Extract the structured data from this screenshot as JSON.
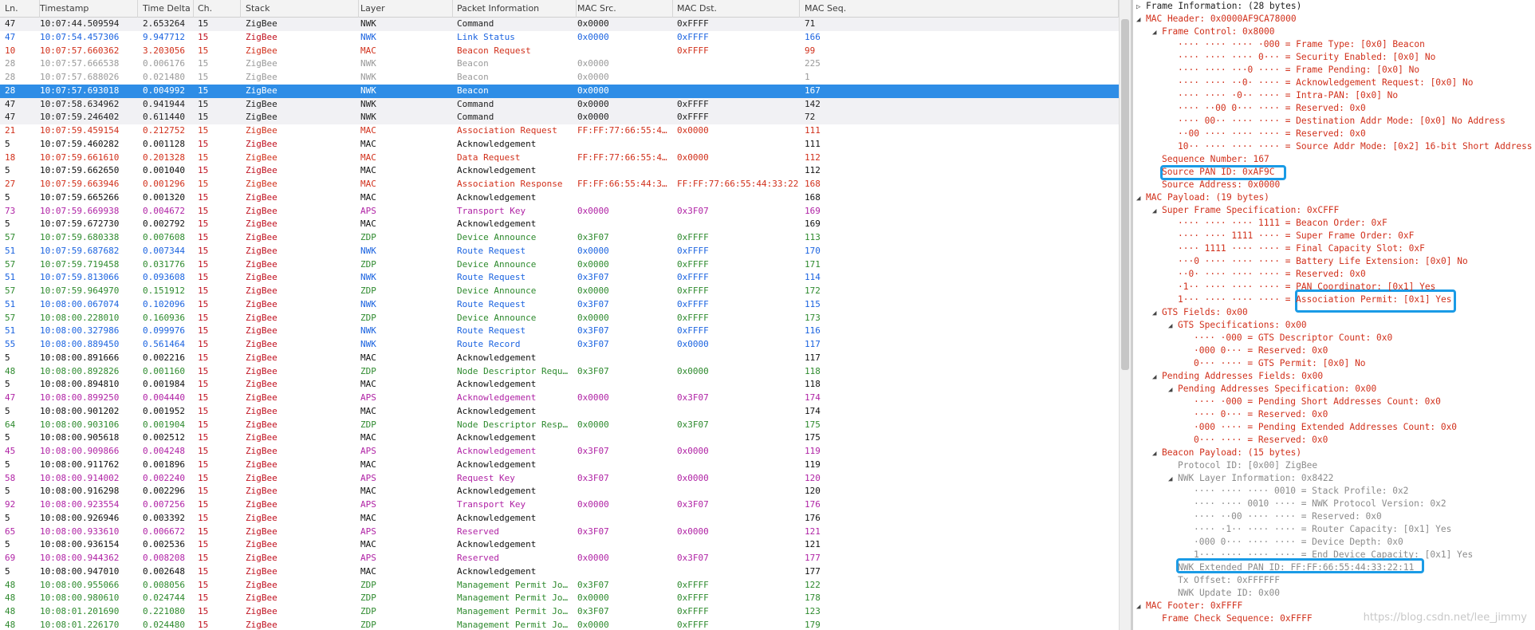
{
  "columns": [
    "Ln.",
    "Timestamp",
    "Time Delta",
    "Ch.",
    "Stack",
    "Layer",
    "Packet Information",
    "MAC Src.",
    "MAC Dst.",
    "MAC Seq."
  ],
  "packets": [
    {
      "ln": "47",
      "ts": "10:07:44.509594",
      "td": "2.653264",
      "ch": "15",
      "st": "ZigBee",
      "ly": "NWK",
      "pi": "Command",
      "ms": "0x0000",
      "md": "0xFFFF",
      "sq": "71",
      "kind": "cmd",
      "alt": true
    },
    {
      "ln": "47",
      "ts": "10:07:54.457306",
      "td": "9.947712",
      "ch": "15",
      "st": "ZigBee",
      "ly": "NWK",
      "pi": "Link Status",
      "ms": "0x0000",
      "md": "0xFFFF",
      "sq": "166",
      "kind": "nwk",
      "alt": false
    },
    {
      "ln": "10",
      "ts": "10:07:57.660362",
      "td": "3.203056",
      "ch": "15",
      "st": "ZigBee",
      "ly": "MAC",
      "pi": "Beacon Request",
      "ms": "",
      "md": "0xFFFF",
      "sq": "99",
      "kind": "mac",
      "alt": false
    },
    {
      "ln": "28",
      "ts": "10:07:57.666538",
      "td": "0.006176",
      "ch": "15",
      "st": "ZigBee",
      "ly": "NWK",
      "pi": "Beacon",
      "ms": "0x0000",
      "md": "",
      "sq": "225",
      "kind": "beacon",
      "alt": false
    },
    {
      "ln": "28",
      "ts": "10:07:57.688026",
      "td": "0.021480",
      "ch": "15",
      "st": "ZigBee",
      "ly": "NWK",
      "pi": "Beacon",
      "ms": "0x0000",
      "md": "",
      "sq": "1",
      "kind": "beacon",
      "alt": false
    },
    {
      "ln": "28",
      "ts": "10:07:57.693018",
      "td": "0.004992",
      "ch": "15",
      "st": "ZigBee",
      "ly": "NWK",
      "pi": "Beacon",
      "ms": "0x0000",
      "md": "",
      "sq": "167",
      "kind": "beacon",
      "alt": false,
      "selected": true
    },
    {
      "ln": "47",
      "ts": "10:07:58.634962",
      "td": "0.941944",
      "ch": "15",
      "st": "ZigBee",
      "ly": "NWK",
      "pi": "Command",
      "ms": "0x0000",
      "md": "0xFFFF",
      "sq": "142",
      "kind": "cmd",
      "alt": true
    },
    {
      "ln": "47",
      "ts": "10:07:59.246402",
      "td": "0.611440",
      "ch": "15",
      "st": "ZigBee",
      "ly": "NWK",
      "pi": "Command",
      "ms": "0x0000",
      "md": "0xFFFF",
      "sq": "72",
      "kind": "cmd",
      "alt": true
    },
    {
      "ln": "21",
      "ts": "10:07:59.459154",
      "td": "0.212752",
      "ch": "15",
      "st": "ZigBee",
      "ly": "MAC",
      "pi": "Association Request",
      "ms": "FF:FF:77:66:55:4…",
      "md": "0x0000",
      "sq": "111",
      "kind": "mac",
      "alt": false
    },
    {
      "ln": "5",
      "ts": "10:07:59.460282",
      "td": "0.001128",
      "ch": "15",
      "st": "ZigBee",
      "ly": "MAC",
      "pi": "Acknowledgement",
      "ms": "",
      "md": "",
      "sq": "111",
      "kind": "ack",
      "alt": false
    },
    {
      "ln": "18",
      "ts": "10:07:59.661610",
      "td": "0.201328",
      "ch": "15",
      "st": "ZigBee",
      "ly": "MAC",
      "pi": "Data Request",
      "ms": "FF:FF:77:66:55:4…",
      "md": "0x0000",
      "sq": "112",
      "kind": "mac",
      "alt": false
    },
    {
      "ln": "5",
      "ts": "10:07:59.662650",
      "td": "0.001040",
      "ch": "15",
      "st": "ZigBee",
      "ly": "MAC",
      "pi": "Acknowledgement",
      "ms": "",
      "md": "",
      "sq": "112",
      "kind": "ack",
      "alt": false
    },
    {
      "ln": "27",
      "ts": "10:07:59.663946",
      "td": "0.001296",
      "ch": "15",
      "st": "ZigBee",
      "ly": "MAC",
      "pi": "Association Response",
      "ms": "FF:FF:66:55:44:3…",
      "md": "FF:FF:77:66:55:44:33:22",
      "sq": "168",
      "kind": "mac",
      "alt": false
    },
    {
      "ln": "5",
      "ts": "10:07:59.665266",
      "td": "0.001320",
      "ch": "15",
      "st": "ZigBee",
      "ly": "MAC",
      "pi": "Acknowledgement",
      "ms": "",
      "md": "",
      "sq": "168",
      "kind": "ack",
      "alt": false
    },
    {
      "ln": "73",
      "ts": "10:07:59.669938",
      "td": "0.004672",
      "ch": "15",
      "st": "ZigBee",
      "ly": "APS",
      "pi": "Transport Key",
      "ms": "0x0000",
      "md": "0x3F07",
      "sq": "169",
      "kind": "aps",
      "alt": false
    },
    {
      "ln": "5",
      "ts": "10:07:59.672730",
      "td": "0.002792",
      "ch": "15",
      "st": "ZigBee",
      "ly": "MAC",
      "pi": "Acknowledgement",
      "ms": "",
      "md": "",
      "sq": "169",
      "kind": "ack",
      "alt": false
    },
    {
      "ln": "57",
      "ts": "10:07:59.680338",
      "td": "0.007608",
      "ch": "15",
      "st": "ZigBee",
      "ly": "ZDP",
      "pi": "Device Announce",
      "ms": "0x3F07",
      "md": "0xFFFF",
      "sq": "113",
      "kind": "zdp",
      "alt": false
    },
    {
      "ln": "51",
      "ts": "10:07:59.687682",
      "td": "0.007344",
      "ch": "15",
      "st": "ZigBee",
      "ly": "NWK",
      "pi": "Route Request",
      "ms": "0x0000",
      "md": "0xFFFF",
      "sq": "170",
      "kind": "nwk",
      "alt": false
    },
    {
      "ln": "57",
      "ts": "10:07:59.719458",
      "td": "0.031776",
      "ch": "15",
      "st": "ZigBee",
      "ly": "ZDP",
      "pi": "Device Announce",
      "ms": "0x0000",
      "md": "0xFFFF",
      "sq": "171",
      "kind": "zdp",
      "alt": false
    },
    {
      "ln": "51",
      "ts": "10:07:59.813066",
      "td": "0.093608",
      "ch": "15",
      "st": "ZigBee",
      "ly": "NWK",
      "pi": "Route Request",
      "ms": "0x3F07",
      "md": "0xFFFF",
      "sq": "114",
      "kind": "nwk",
      "alt": false
    },
    {
      "ln": "57",
      "ts": "10:07:59.964970",
      "td": "0.151912",
      "ch": "15",
      "st": "ZigBee",
      "ly": "ZDP",
      "pi": "Device Announce",
      "ms": "0x0000",
      "md": "0xFFFF",
      "sq": "172",
      "kind": "zdp",
      "alt": false
    },
    {
      "ln": "51",
      "ts": "10:08:00.067074",
      "td": "0.102096",
      "ch": "15",
      "st": "ZigBee",
      "ly": "NWK",
      "pi": "Route Request",
      "ms": "0x3F07",
      "md": "0xFFFF",
      "sq": "115",
      "kind": "nwk",
      "alt": false
    },
    {
      "ln": "57",
      "ts": "10:08:00.228010",
      "td": "0.160936",
      "ch": "15",
      "st": "ZigBee",
      "ly": "ZDP",
      "pi": "Device Announce",
      "ms": "0x0000",
      "md": "0xFFFF",
      "sq": "173",
      "kind": "zdp",
      "alt": false
    },
    {
      "ln": "51",
      "ts": "10:08:00.327986",
      "td": "0.099976",
      "ch": "15",
      "st": "ZigBee",
      "ly": "NWK",
      "pi": "Route Request",
      "ms": "0x3F07",
      "md": "0xFFFF",
      "sq": "116",
      "kind": "nwk",
      "alt": false
    },
    {
      "ln": "55",
      "ts": "10:08:00.889450",
      "td": "0.561464",
      "ch": "15",
      "st": "ZigBee",
      "ly": "NWK",
      "pi": "Route Record",
      "ms": "0x3F07",
      "md": "0x0000",
      "sq": "117",
      "kind": "nwk",
      "alt": false
    },
    {
      "ln": "5",
      "ts": "10:08:00.891666",
      "td": "0.002216",
      "ch": "15",
      "st": "ZigBee",
      "ly": "MAC",
      "pi": "Acknowledgement",
      "ms": "",
      "md": "",
      "sq": "117",
      "kind": "ack",
      "alt": false
    },
    {
      "ln": "48",
      "ts": "10:08:00.892826",
      "td": "0.001160",
      "ch": "15",
      "st": "ZigBee",
      "ly": "ZDP",
      "pi": "Node Descriptor Requ…",
      "ms": "0x3F07",
      "md": "0x0000",
      "sq": "118",
      "kind": "zdp",
      "alt": false
    },
    {
      "ln": "5",
      "ts": "10:08:00.894810",
      "td": "0.001984",
      "ch": "15",
      "st": "ZigBee",
      "ly": "MAC",
      "pi": "Acknowledgement",
      "ms": "",
      "md": "",
      "sq": "118",
      "kind": "ack",
      "alt": false
    },
    {
      "ln": "47",
      "ts": "10:08:00.899250",
      "td": "0.004440",
      "ch": "15",
      "st": "ZigBee",
      "ly": "APS",
      "pi": "Acknowledgement",
      "ms": "0x0000",
      "md": "0x3F07",
      "sq": "174",
      "kind": "aps",
      "alt": false
    },
    {
      "ln": "5",
      "ts": "10:08:00.901202",
      "td": "0.001952",
      "ch": "15",
      "st": "ZigBee",
      "ly": "MAC",
      "pi": "Acknowledgement",
      "ms": "",
      "md": "",
      "sq": "174",
      "kind": "ack",
      "alt": false
    },
    {
      "ln": "64",
      "ts": "10:08:00.903106",
      "td": "0.001904",
      "ch": "15",
      "st": "ZigBee",
      "ly": "ZDP",
      "pi": "Node Descriptor Resp…",
      "ms": "0x0000",
      "md": "0x3F07",
      "sq": "175",
      "kind": "zdp",
      "alt": false
    },
    {
      "ln": "5",
      "ts": "10:08:00.905618",
      "td": "0.002512",
      "ch": "15",
      "st": "ZigBee",
      "ly": "MAC",
      "pi": "Acknowledgement",
      "ms": "",
      "md": "",
      "sq": "175",
      "kind": "ack",
      "alt": false
    },
    {
      "ln": "45",
      "ts": "10:08:00.909866",
      "td": "0.004248",
      "ch": "15",
      "st": "ZigBee",
      "ly": "APS",
      "pi": "Acknowledgement",
      "ms": "0x3F07",
      "md": "0x0000",
      "sq": "119",
      "kind": "aps",
      "alt": false
    },
    {
      "ln": "5",
      "ts": "10:08:00.911762",
      "td": "0.001896",
      "ch": "15",
      "st": "ZigBee",
      "ly": "MAC",
      "pi": "Acknowledgement",
      "ms": "",
      "md": "",
      "sq": "119",
      "kind": "ack",
      "alt": false
    },
    {
      "ln": "58",
      "ts": "10:08:00.914002",
      "td": "0.002240",
      "ch": "15",
      "st": "ZigBee",
      "ly": "APS",
      "pi": "Request Key",
      "ms": "0x3F07",
      "md": "0x0000",
      "sq": "120",
      "kind": "aps",
      "alt": false
    },
    {
      "ln": "5",
      "ts": "10:08:00.916298",
      "td": "0.002296",
      "ch": "15",
      "st": "ZigBee",
      "ly": "MAC",
      "pi": "Acknowledgement",
      "ms": "",
      "md": "",
      "sq": "120",
      "kind": "ack",
      "alt": false
    },
    {
      "ln": "92",
      "ts": "10:08:00.923554",
      "td": "0.007256",
      "ch": "15",
      "st": "ZigBee",
      "ly": "APS",
      "pi": "Transport Key",
      "ms": "0x0000",
      "md": "0x3F07",
      "sq": "176",
      "kind": "aps",
      "alt": false
    },
    {
      "ln": "5",
      "ts": "10:08:00.926946",
      "td": "0.003392",
      "ch": "15",
      "st": "ZigBee",
      "ly": "MAC",
      "pi": "Acknowledgement",
      "ms": "",
      "md": "",
      "sq": "176",
      "kind": "ack",
      "alt": false
    },
    {
      "ln": "65",
      "ts": "10:08:00.933610",
      "td": "0.006672",
      "ch": "15",
      "st": "ZigBee",
      "ly": "APS",
      "pi": "Reserved",
      "ms": "0x3F07",
      "md": "0x0000",
      "sq": "121",
      "kind": "aps",
      "alt": false
    },
    {
      "ln": "5",
      "ts": "10:08:00.936154",
      "td": "0.002536",
      "ch": "15",
      "st": "ZigBee",
      "ly": "MAC",
      "pi": "Acknowledgement",
      "ms": "",
      "md": "",
      "sq": "121",
      "kind": "ack",
      "alt": false
    },
    {
      "ln": "69",
      "ts": "10:08:00.944362",
      "td": "0.008208",
      "ch": "15",
      "st": "ZigBee",
      "ly": "APS",
      "pi": "Reserved",
      "ms": "0x0000",
      "md": "0x3F07",
      "sq": "177",
      "kind": "aps",
      "alt": false
    },
    {
      "ln": "5",
      "ts": "10:08:00.947010",
      "td": "0.002648",
      "ch": "15",
      "st": "ZigBee",
      "ly": "MAC",
      "pi": "Acknowledgement",
      "ms": "",
      "md": "",
      "sq": "177",
      "kind": "ack",
      "alt": false
    },
    {
      "ln": "48",
      "ts": "10:08:00.955066",
      "td": "0.008056",
      "ch": "15",
      "st": "ZigBee",
      "ly": "ZDP",
      "pi": "Management Permit Jo…",
      "ms": "0x3F07",
      "md": "0xFFFF",
      "sq": "122",
      "kind": "zdp",
      "alt": false
    },
    {
      "ln": "48",
      "ts": "10:08:00.980610",
      "td": "0.024744",
      "ch": "15",
      "st": "ZigBee",
      "ly": "ZDP",
      "pi": "Management Permit Jo…",
      "ms": "0x0000",
      "md": "0xFFFF",
      "sq": "178",
      "kind": "zdp",
      "alt": false
    },
    {
      "ln": "48",
      "ts": "10:08:01.201690",
      "td": "0.221080",
      "ch": "15",
      "st": "ZigBee",
      "ly": "ZDP",
      "pi": "Management Permit Jo…",
      "ms": "0x3F07",
      "md": "0xFFFF",
      "sq": "123",
      "kind": "zdp",
      "alt": false
    },
    {
      "ln": "48",
      "ts": "10:08:01.226170",
      "td": "0.024480",
      "ch": "15",
      "st": "ZigBee",
      "ly": "ZDP",
      "pi": "Management Permit Jo…",
      "ms": "0x0000",
      "md": "0xFFFF",
      "sq": "179",
      "kind": "zdp",
      "alt": false
    }
  ],
  "details": [
    {
      "t": "Frame Information: (28 bytes)",
      "lvl": 0,
      "exp": "collapsed",
      "c": "black"
    },
    {
      "t": "MAC Header: 0x0000AF9CA78000",
      "lvl": 0,
      "exp": "expanded"
    },
    {
      "t": "Frame Control: 0x8000",
      "lvl": 1,
      "exp": "expanded"
    },
    {
      "t": "···· ···· ···· ·000 = Frame Type: [0x0] Beacon",
      "lvl": 2
    },
    {
      "t": "···· ···· ···· 0··· = Security Enabled: [0x0] No",
      "lvl": 2
    },
    {
      "t": "···· ···· ···0 ···· = Frame Pending: [0x0] No",
      "lvl": 2
    },
    {
      "t": "···· ···· ··0· ···· = Acknowledgement Request: [0x0] No",
      "lvl": 2
    },
    {
      "t": "···· ···· ·0·· ···· = Intra-PAN: [0x0] No",
      "lvl": 2
    },
    {
      "t": "···· ··00 0··· ···· = Reserved: 0x0",
      "lvl": 2
    },
    {
      "t": "···· 00·· ···· ···· = Destination Addr Mode: [0x0] No Address",
      "lvl": 2
    },
    {
      "t": "··00 ···· ···· ···· = Reserved: 0x0",
      "lvl": 2
    },
    {
      "t": "10·· ···· ···· ···· = Source Addr Mode: [0x2] 16-bit Short Address",
      "lvl": 2
    },
    {
      "t": "Sequence Number: 167",
      "lvl": 1
    },
    {
      "t": "Source PAN ID: 0xAF9C",
      "lvl": 1
    },
    {
      "t": "Source Address: 0x0000",
      "lvl": 1
    },
    {
      "t": "MAC Payload: (19 bytes)",
      "lvl": 0,
      "exp": "expanded"
    },
    {
      "t": "Super Frame Specification: 0xCFFF",
      "lvl": 1,
      "exp": "expanded"
    },
    {
      "t": "···· ···· ···· 1111 = Beacon Order: 0xF",
      "lvl": 2
    },
    {
      "t": "···· ···· 1111 ···· = Super Frame Order: 0xF",
      "lvl": 2
    },
    {
      "t": "···· 1111 ···· ···· = Final Capacity Slot: 0xF",
      "lvl": 2
    },
    {
      "t": "···0 ···· ···· ···· = Battery Life Extension: [0x0] No",
      "lvl": 2
    },
    {
      "t": "··0· ···· ···· ···· = Reserved: 0x0",
      "lvl": 2
    },
    {
      "t": "·1·· ···· ···· ···· = PAN Coordinator: [0x1] Yes",
      "lvl": 2
    },
    {
      "t": "1··· ···· ···· ···· = Association Permit: [0x1] Yes",
      "lvl": 2
    },
    {
      "t": "GTS Fields: 0x00",
      "lvl": 1,
      "exp": "expanded"
    },
    {
      "t": "GTS Specifications: 0x00",
      "lvl": 2,
      "exp": "expanded"
    },
    {
      "t": "···· ·000 = GTS Descriptor Count: 0x0",
      "lvl": 3
    },
    {
      "t": "·000 0··· = Reserved: 0x0",
      "lvl": 3
    },
    {
      "t": "0··· ···· = GTS Permit: [0x0] No",
      "lvl": 3
    },
    {
      "t": "Pending Addresses Fields: 0x00",
      "lvl": 1,
      "exp": "expanded"
    },
    {
      "t": "Pending Addresses Specification: 0x00",
      "lvl": 2,
      "exp": "expanded"
    },
    {
      "t": "···· ·000 = Pending Short Addresses Count: 0x0",
      "lvl": 3
    },
    {
      "t": "···· 0··· = Reserved: 0x0",
      "lvl": 3
    },
    {
      "t": "·000 ···· = Pending Extended Addresses Count: 0x0",
      "lvl": 3
    },
    {
      "t": "0··· ···· = Reserved: 0x0",
      "lvl": 3
    },
    {
      "t": "Beacon Payload: (15 bytes)",
      "lvl": 1,
      "exp": "expanded"
    },
    {
      "t": "Protocol ID: [0x00] ZigBee",
      "lvl": 2,
      "c": "gray"
    },
    {
      "t": "NWK Layer Information: 0x8422",
      "lvl": 2,
      "exp": "expanded",
      "c": "gray"
    },
    {
      "t": "···· ···· ···· 0010 = Stack Profile: 0x2",
      "lvl": 3,
      "c": "gray"
    },
    {
      "t": "···· ···· 0010 ···· = NWK Protocol Version: 0x2",
      "lvl": 3,
      "c": "gray"
    },
    {
      "t": "···· ··00 ···· ···· = Reserved: 0x0",
      "lvl": 3,
      "c": "gray"
    },
    {
      "t": "···· ·1·· ···· ···· = Router Capacity: [0x1] Yes",
      "lvl": 3,
      "c": "gray"
    },
    {
      "t": "·000 0··· ···· ···· = Device Depth: 0x0",
      "lvl": 3,
      "c": "gray"
    },
    {
      "t": "1··· ···· ···· ···· = End Device Capacity: [0x1] Yes",
      "lvl": 3,
      "c": "gray"
    },
    {
      "t": "NWK Extended PAN ID: FF:FF:66:55:44:33:22:11",
      "lvl": 2,
      "c": "gray"
    },
    {
      "t": "Tx Offset: 0xFFFFFF",
      "lvl": 2,
      "c": "gray"
    },
    {
      "t": "NWK Update ID: 0x00",
      "lvl": 2,
      "c": "gray"
    },
    {
      "t": "MAC Footer: 0xFFFF",
      "lvl": 0,
      "exp": "expanded"
    },
    {
      "t": "Frame Check Sequence: 0xFFFF",
      "lvl": 1
    }
  ],
  "watermark": "https://blog.csdn.net/lee_jimmy",
  "colors": {
    "selected": "#2e8de6",
    "highlight_box": "#1a9be6",
    "nwk": "#1c64e0",
    "mac": "#d1301b",
    "aps": "#b023a5",
    "zdp": "#2e8a2e"
  }
}
